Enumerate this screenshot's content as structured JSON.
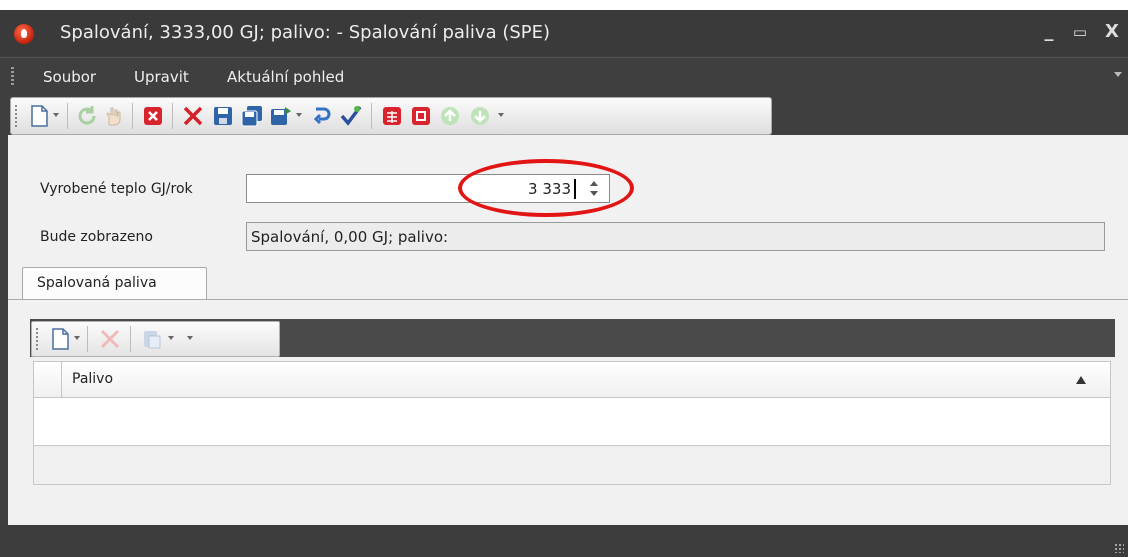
{
  "window": {
    "title": "Spalování,  3333,00 GJ; palivo:  - Spalování paliva (SPE)",
    "minimize": "_",
    "maximize": "▭",
    "close": "X"
  },
  "menu": {
    "items": [
      "Soubor",
      "Upravit",
      "Aktuální pohled"
    ]
  },
  "toolbar": {
    "icons": [
      "new-document-icon",
      "refresh-icon",
      "hand-icon",
      "close-red-icon",
      "delete-icon",
      "save-icon",
      "save-all-icon",
      "save-as-icon",
      "undo-icon",
      "check-icon",
      "table-icon",
      "report-icon",
      "arrow-up-icon",
      "arrow-down-icon"
    ]
  },
  "form": {
    "heat_label": "Vyrobené teplo GJ/rok",
    "heat_value": "3 333",
    "display_label": "Bude zobrazeno",
    "display_value": "Spalování,  0,00 GJ; palivo:"
  },
  "tabs": [
    {
      "label": "Spalovaná paliva",
      "active": true
    }
  ],
  "grid": {
    "columns": [
      "Palivo"
    ],
    "sort": "ascending",
    "rows": []
  },
  "colors": {
    "chrome": "#3f3f3f",
    "highlight_oval": "#e21414",
    "form_bg": "#f1f1f1"
  }
}
